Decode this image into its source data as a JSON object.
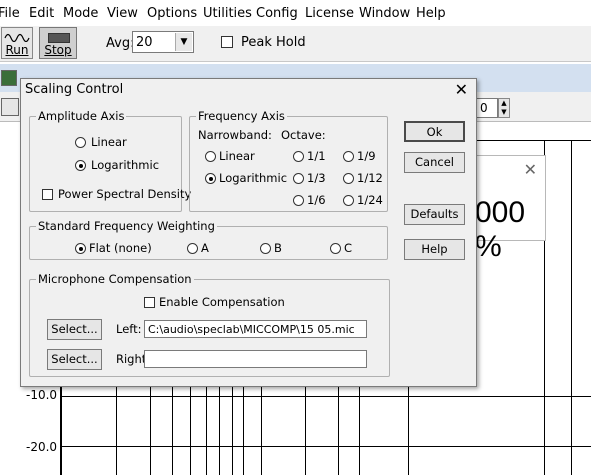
{
  "menubar": {
    "items": [
      "File",
      "Edit",
      "Mode",
      "View",
      "Options",
      "Utilities",
      "Config",
      "License",
      "Window",
      "Help"
    ]
  },
  "toolbar": {
    "run_label": "Run",
    "stop_label": "Stop",
    "avg_label": "Avg:",
    "avg_value": "20",
    "peak_hold_label": "Peak Hold",
    "peak_hold_checked": false
  },
  "background_window": {
    "spinner_value": "0",
    "percent_readout": "000 %",
    "y_ticks": [
      "-10.0",
      "-20.0"
    ]
  },
  "dialog": {
    "title": "Scaling Control",
    "amplitude_axis": {
      "title": "Amplitude Axis",
      "options": [
        "Linear",
        "Logarithmic"
      ],
      "selected": "Logarithmic",
      "psd_label": "Power Spectral Density",
      "psd_checked": false
    },
    "frequency_axis": {
      "title": "Frequency Axis",
      "narrowband_label": "Narrowband:",
      "narrowband_options": [
        "Linear",
        "Logarithmic"
      ],
      "narrowband_selected": "Logarithmic",
      "octave_label": "Octave:",
      "octave_options": [
        "1/1",
        "1/9",
        "1/3",
        "1/12",
        "1/6",
        "1/24"
      ]
    },
    "weighting": {
      "title": "Standard Frequency Weighting",
      "options": [
        "Flat (none)",
        "A",
        "B",
        "C"
      ],
      "selected": "Flat (none)"
    },
    "mic_comp": {
      "title": "Microphone Compensation",
      "enable_label": "Enable Compensation",
      "enable_checked": false,
      "select_label": "Select...",
      "left_label": "Left:",
      "left_value": "C:\\audio\\speclab\\MICCOMP\\15          05.mic",
      "right_label": "Right:",
      "right_value": ""
    },
    "buttons": {
      "ok": "Ok",
      "cancel": "Cancel",
      "defaults": "Defaults",
      "help": "Help"
    }
  }
}
